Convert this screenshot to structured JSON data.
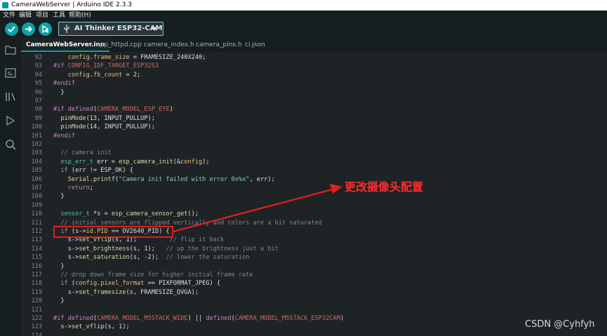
{
  "window": {
    "title": "CameraWebServer | Arduino IDE 2.3.3"
  },
  "menubar": {
    "items": [
      "文件",
      "编辑",
      "项目",
      "工具",
      "帮助(H)"
    ]
  },
  "toolbar": {
    "board": "AI Thinker ESP32-CAM"
  },
  "tabs": [
    "CameraWebServer.ino",
    "app_httpd.cpp",
    "camera_index.h",
    "camera_pins.h",
    "ci.json"
  ],
  "editor": {
    "lines": [
      {
        "n": "92",
        "t": "    config.frame_size = FRAMESIZE_240X240;"
      },
      {
        "n": "93",
        "t": "#if CONFIG_IDF_TARGET_ESP32S3"
      },
      {
        "n": "94",
        "t": "    config.fb_count = 2;"
      },
      {
        "n": "95",
        "t": "#endif"
      },
      {
        "n": "96",
        "t": "  }"
      },
      {
        "n": "97",
        "t": ""
      },
      {
        "n": "98",
        "t": "#if defined(CAMERA_MODEL_ESP_EYE)"
      },
      {
        "n": "99",
        "t": "  pinMode(13, INPUT_PULLUP);"
      },
      {
        "n": "100",
        "t": "  pinMode(14, INPUT_PULLUP);"
      },
      {
        "n": "101",
        "t": "#endif"
      },
      {
        "n": "102",
        "t": ""
      },
      {
        "n": "103",
        "t": "  // camera init"
      },
      {
        "n": "104",
        "t": "  esp_err_t err = esp_camera_init(&config);"
      },
      {
        "n": "105",
        "t": "  if (err != ESP_OK) {"
      },
      {
        "n": "106",
        "t": "    Serial.printf(\"Camera init failed with error 0x%x\", err);"
      },
      {
        "n": "107",
        "t": "    return;"
      },
      {
        "n": "108",
        "t": "  }"
      },
      {
        "n": "109",
        "t": ""
      },
      {
        "n": "110",
        "t": "  sensor_t *s = esp_camera_sensor_get();"
      },
      {
        "n": "111",
        "t": "  // initial sensors are flipped vertically and colors are a bit saturated"
      },
      {
        "n": "112",
        "t": "  if (s->id.PID == OV2640_PID) {"
      },
      {
        "n": "113",
        "t": "    s->set_vflip(s, 1);         // flip it back"
      },
      {
        "n": "114",
        "t": "    s->set_brightness(s, 1);   // up the brightness just a bit"
      },
      {
        "n": "115",
        "t": "    s->set_saturation(s, -2);  // lower the saturation"
      },
      {
        "n": "116",
        "t": "  }"
      },
      {
        "n": "117",
        "t": "  // drop down frame size for higher initial frame rate"
      },
      {
        "n": "118",
        "t": "  if (config.pixel_format == PIXFORMAT_JPEG) {"
      },
      {
        "n": "119",
        "t": "    s->set_framesize(s, FRAMESIZE_QVGA);"
      },
      {
        "n": "120",
        "t": "  }"
      },
      {
        "n": "121",
        "t": ""
      },
      {
        "n": "122",
        "t": "#if defined(CAMERA_MODEL_M5STACK_WIDE) || defined(CAMERA_MODEL_M5STACK_ESP32CAM)"
      },
      {
        "n": "123",
        "t": "  s->set_vflip(s, 1);"
      },
      {
        "n": "124",
        "t": ""
      }
    ]
  },
  "annotation": {
    "text": "更改摄像头配置"
  },
  "watermark": {
    "text": "CSDN @Cyhfyh"
  },
  "colors": {
    "accent": "#0ca1a6",
    "annotation": "#e02020",
    "editor_bg": "#1e2326"
  },
  "icons": {
    "verify": "check-icon",
    "upload": "arrow-right-icon",
    "debug": "debug-icon"
  }
}
